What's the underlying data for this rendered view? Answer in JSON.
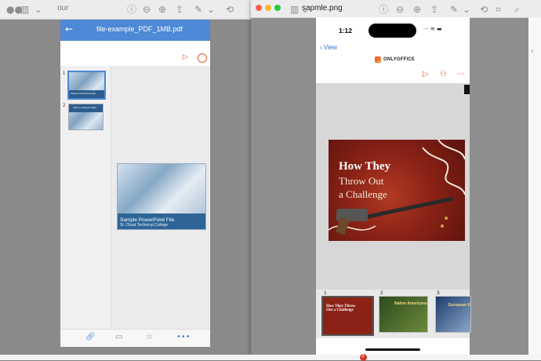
{
  "back_window": {
    "toolbar_title": "our",
    "app_title": "file-example_PDF_1MB.pdf",
    "thumbnails": [
      {
        "num": "1",
        "caption": "Sample PowerPoint File"
      },
      {
        "num": "2",
        "caption": "This is a Sample Slide"
      }
    ],
    "slide_title": "Sample PowerPoint File",
    "slide_subtitle": "St. Cloud Technical College"
  },
  "front_window": {
    "file_title": "sapmle.png",
    "phone": {
      "time": "1:12",
      "back_label": "View",
      "logo_text": "ONLYOFFICE",
      "slide_line1": "How They",
      "slide_line2": "Throw Out",
      "slide_line3": "a Challenge",
      "thumbnails": [
        {
          "num": "1",
          "caption": "How They Throw Out a Challenge"
        },
        {
          "num": "2",
          "caption": "Native Americans"
        },
        {
          "num": "3",
          "caption": "European K"
        }
      ]
    }
  },
  "badge_count": "3",
  "colors": {
    "accent_blue": "#4d89d5",
    "onlyoffice_orange": "#e35a2a",
    "slide_red": "#8b2216"
  }
}
